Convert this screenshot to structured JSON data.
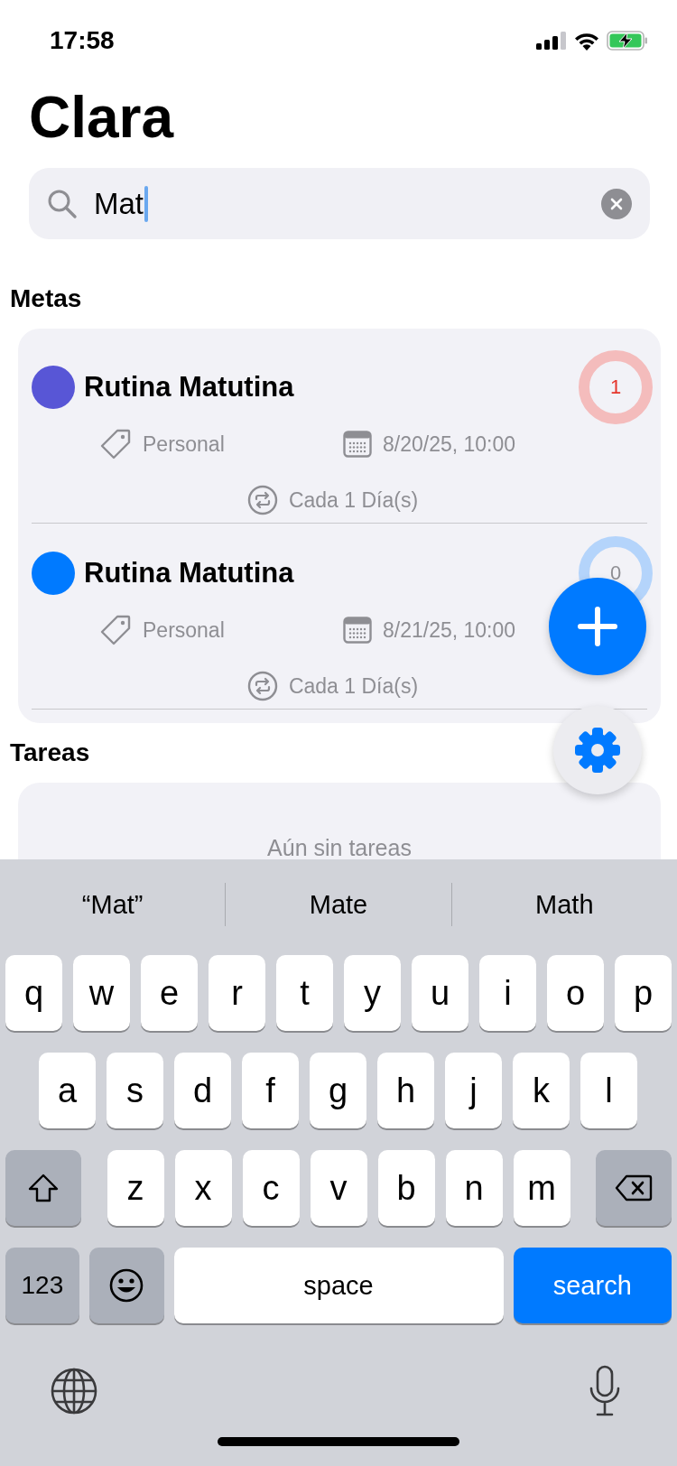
{
  "status_bar": {
    "time": "17:58"
  },
  "title": "Clara",
  "search": {
    "value": "Mat"
  },
  "sections": [
    {
      "heading": "Metas",
      "goals": [
        {
          "name": "Rutina Matutina",
          "color": "#5856d6",
          "overdue": true,
          "count": "1",
          "category": "Personal",
          "date": "8/20/25, 10:00",
          "repeat": "Cada 1 Día(s)"
        },
        {
          "name": "Rutina Matutina",
          "color": "#007aff",
          "overdue": false,
          "count": "0",
          "category": "Personal",
          "date": "8/21/25, 10:00",
          "repeat": "Cada 1 Día(s)"
        }
      ]
    },
    {
      "heading": "Tareas",
      "empty": "Aún sin tareas"
    }
  ],
  "keyboard": {
    "suggestions": [
      "“Mat”",
      "Mate",
      "Math"
    ],
    "letter_rows": [
      [
        "q",
        "w",
        "e",
        "r",
        "t",
        "y",
        "u",
        "i",
        "o",
        "p"
      ],
      [
        "a",
        "s",
        "d",
        "f",
        "g",
        "h",
        "j",
        "k",
        "l"
      ],
      [
        "z",
        "x",
        "c",
        "v",
        "b",
        "n",
        "m"
      ]
    ],
    "numbers_key": "123",
    "space_key": "space",
    "action_key": "search"
  }
}
